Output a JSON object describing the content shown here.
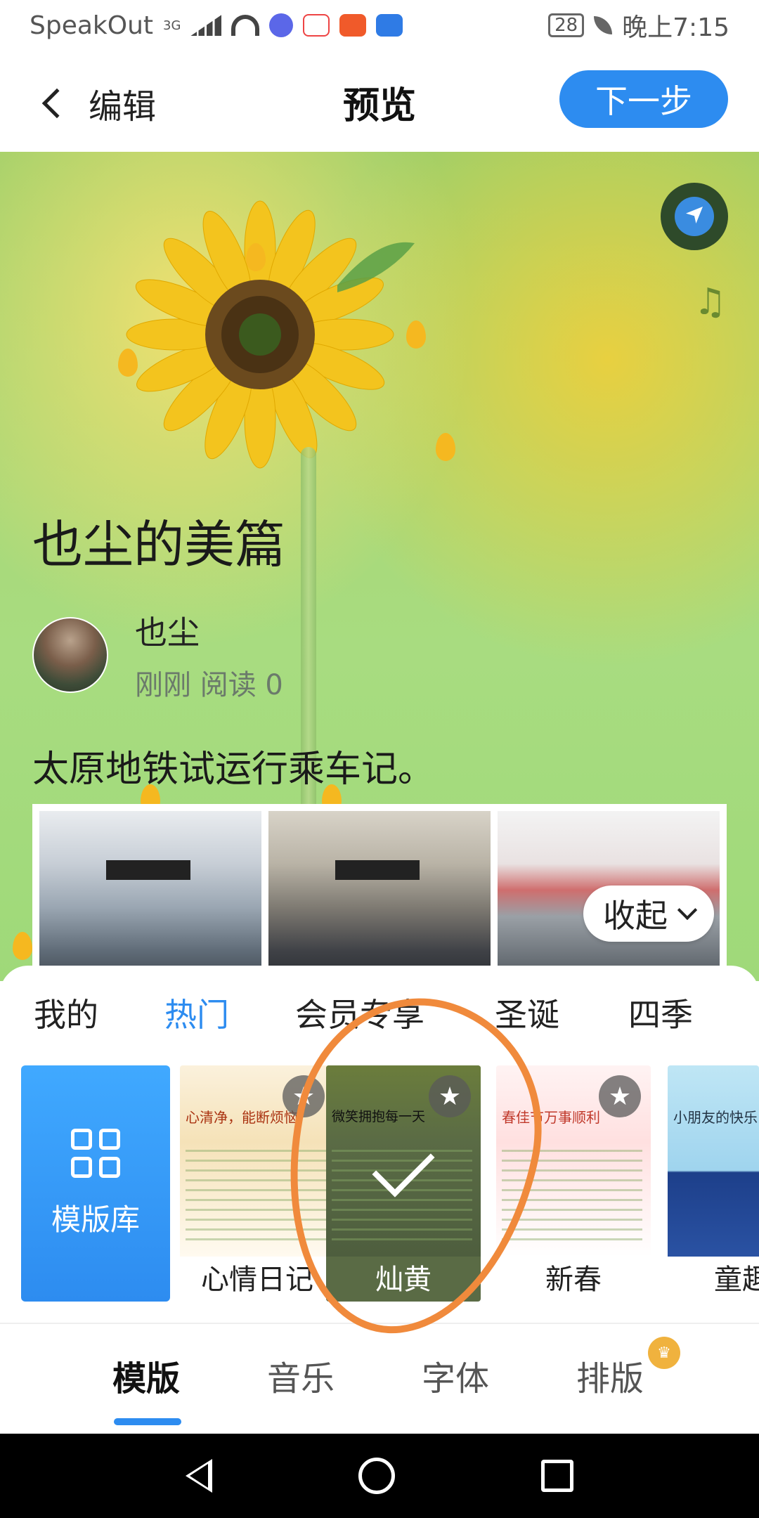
{
  "status_bar": {
    "carrier": "SpeakOut",
    "network": "3G",
    "battery": "28",
    "time": "晚上7:15"
  },
  "header": {
    "back_label": "编辑",
    "title": "预览",
    "next_label": "下一步"
  },
  "article": {
    "title": "也尘的美篇",
    "author": "也尘",
    "meta": "刚刚  阅读 0",
    "description": "太原地铁试运行乘车记。",
    "collapse_label": "收起",
    "icons": {
      "badge": "plane-badge-icon",
      "music": "music-note-icon"
    }
  },
  "template_tabs": [
    "我的",
    "热门",
    "会员专享",
    "圣诞",
    "四季"
  ],
  "active_template_tab": "热门",
  "template_library_label": "模版库",
  "templates": [
    {
      "label": "心情日记",
      "thumb_title": "心清净，能断烦恼",
      "selected": false
    },
    {
      "label": "灿黄",
      "thumb_title": "微笑拥抱每一天",
      "selected": true
    },
    {
      "label": "新春",
      "thumb_title": "春佳节万事顺利",
      "selected": false
    },
    {
      "label": "童趣",
      "thumb_title": "小朋友的快乐",
      "selected": false
    }
  ],
  "bottom_tabs": [
    "模版",
    "音乐",
    "字体",
    "排版"
  ],
  "active_bottom_tab": "模版",
  "colors": {
    "accent": "#2d8cf0",
    "annotation": "#f08a3c"
  }
}
